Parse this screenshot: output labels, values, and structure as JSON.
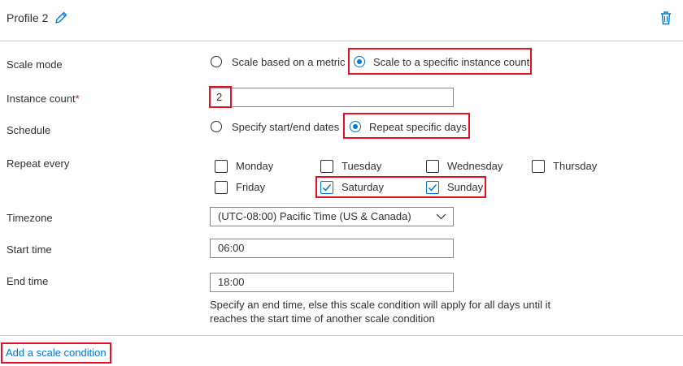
{
  "profile": {
    "title": "Profile 2",
    "edit_icon": "pencil-icon",
    "delete_icon": "trash-icon"
  },
  "scale_mode": {
    "label": "Scale mode",
    "options": [
      "Scale based on a metric",
      "Scale to a specific instance count"
    ],
    "selected": "Scale to a specific instance count"
  },
  "instance_count": {
    "label": "Instance count",
    "required_marker": "*",
    "value": "2"
  },
  "schedule": {
    "label": "Schedule",
    "options": [
      "Specify start/end dates",
      "Repeat specific days"
    ],
    "selected": "Repeat specific days"
  },
  "repeat_every": {
    "label": "Repeat every",
    "days": [
      {
        "name": "Monday",
        "checked": false
      },
      {
        "name": "Tuesday",
        "checked": false
      },
      {
        "name": "Wednesday",
        "checked": false
      },
      {
        "name": "Thursday",
        "checked": false
      },
      {
        "name": "Friday",
        "checked": false
      },
      {
        "name": "Saturday",
        "checked": true
      },
      {
        "name": "Sunday",
        "checked": true
      }
    ]
  },
  "timezone": {
    "label": "Timezone",
    "value": "(UTC-08:00) Pacific Time (US & Canada)"
  },
  "start_time": {
    "label": "Start time",
    "value": "06:00"
  },
  "end_time": {
    "label": "End time",
    "value": "18:00",
    "help": "Specify an end time, else this scale condition will apply for all days until it reaches the start time of another scale condition"
  },
  "footer": {
    "add_link": "Add a scale condition"
  },
  "colors": {
    "accent": "#0078d4",
    "highlight": "#e81123",
    "required": "#a4262c"
  }
}
